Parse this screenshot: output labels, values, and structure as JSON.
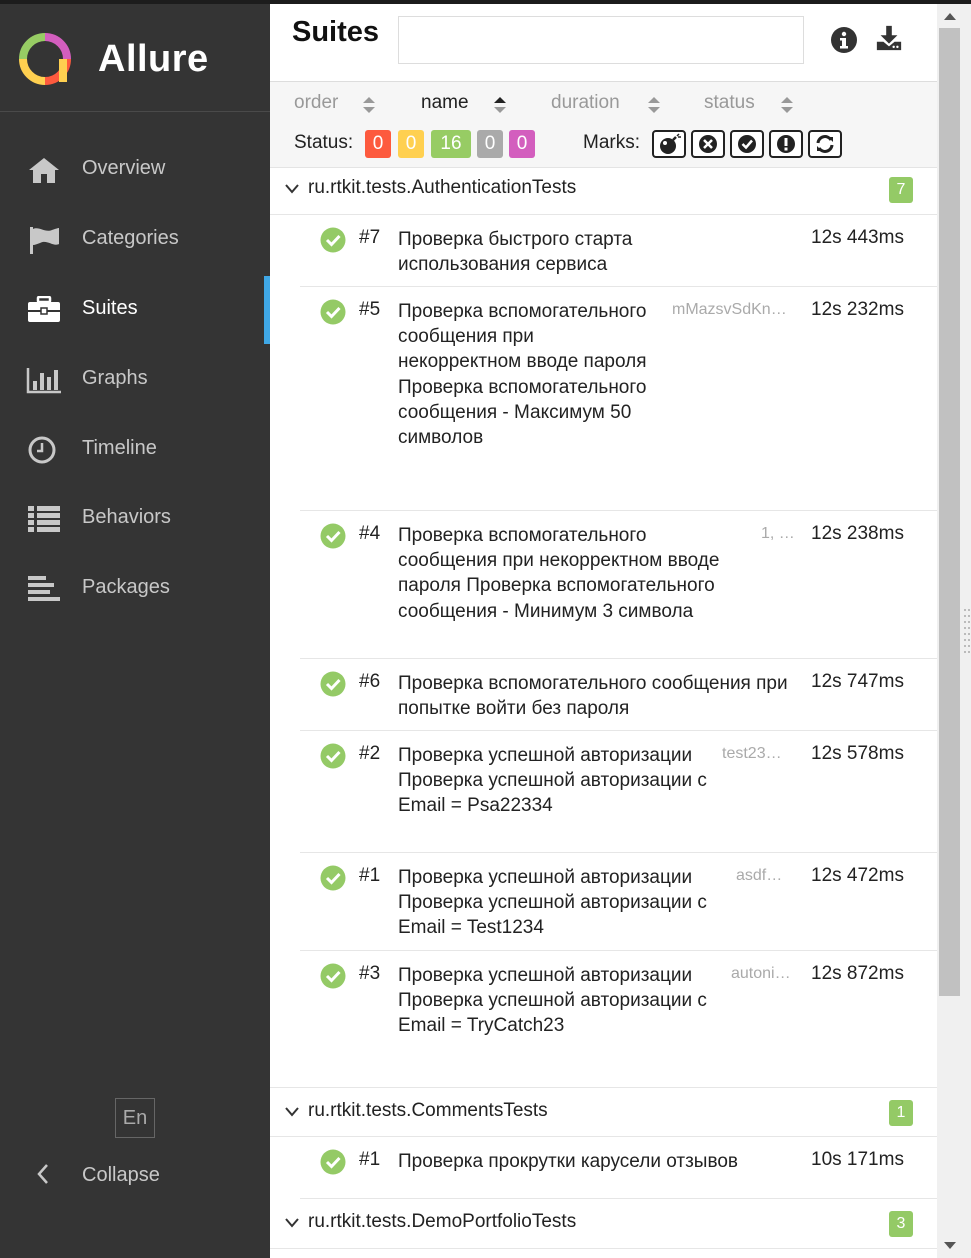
{
  "app": {
    "name": "Allure"
  },
  "sidebar": {
    "items": [
      {
        "label": "Overview",
        "icon": "home-icon"
      },
      {
        "label": "Categories",
        "icon": "flag-icon"
      },
      {
        "label": "Suites",
        "icon": "briefcase-icon",
        "active": true
      },
      {
        "label": "Graphs",
        "icon": "bar-chart-icon"
      },
      {
        "label": "Timeline",
        "icon": "clock-icon"
      },
      {
        "label": "Behaviors",
        "icon": "list-icon"
      },
      {
        "label": "Packages",
        "icon": "align-left-icon"
      }
    ],
    "language": "En",
    "collapse_label": "Collapse"
  },
  "header": {
    "title": "Suites",
    "search_value": ""
  },
  "sort": {
    "order_label": "order",
    "name_label": "name",
    "duration_label": "duration",
    "status_label": "status",
    "active": "name"
  },
  "status_filter": {
    "label": "Status:",
    "counts": [
      "0",
      "0",
      "16",
      "0",
      "0"
    ],
    "colors": [
      "#fd5a3e",
      "#ffd050",
      "#97cc64",
      "#aaaaaa",
      "#d35ebe"
    ]
  },
  "marks": {
    "label": "Marks:",
    "icons": [
      "bomb-icon",
      "close-circle-icon",
      "check-circle-icon",
      "exclamation-circle-icon",
      "refresh-icon"
    ]
  },
  "colors": {
    "sidebar_bg": "#343434",
    "active_indicator": "#3fa7e5",
    "passed": "#94ca66"
  },
  "groups": [
    {
      "name": "ru.rtkit.tests.AuthenticationTests",
      "count": "7",
      "tests": [
        {
          "num": "#7",
          "title": "Проверка быстрого старта использования сервиса",
          "param": "",
          "duration": "12s 443ms"
        },
        {
          "num": "#5",
          "title": "Проверка вспомогательного сообщения при некорректном вводе пароля Проверка вспомогательного сообщения - Максимум 50 символов",
          "param": "mMazsvSdKn…",
          "duration": "12s 232ms"
        },
        {
          "num": "#4",
          "title": "Проверка вспомогательного сообщения при некорректном вводе пароля Проверка вспомогательного сообщения - Минимум 3 символа",
          "param": "1, …",
          "duration": "12s 238ms"
        },
        {
          "num": "#6",
          "title": "Проверка вспомогательного сообщения при попытке войти без пароля",
          "param": "",
          "duration": "12s 747ms"
        },
        {
          "num": "#2",
          "title": "Проверка успешной авторизации Проверка успешной авторизации с Email = Psa22334",
          "param": "test23…",
          "duration": "12s 578ms"
        },
        {
          "num": "#1",
          "title": "Проверка успешной авторизации Проверка успешной авторизации с Email = Test1234",
          "param": "asdf…",
          "duration": "12s 472ms"
        },
        {
          "num": "#3",
          "title": "Проверка успешной авторизации Проверка успешной авторизации с Email = TryCatch23",
          "param": "autoni…",
          "duration": "12s 872ms"
        }
      ]
    },
    {
      "name": "ru.rtkit.tests.CommentsTests",
      "count": "1",
      "tests": [
        {
          "num": "#1",
          "title": "Проверка прокрутки карусели отзывов",
          "param": "",
          "duration": "10s 171ms"
        }
      ]
    },
    {
      "name": "ru.rtkit.tests.DemoPortfolioTests",
      "count": "3",
      "tests": []
    }
  ]
}
